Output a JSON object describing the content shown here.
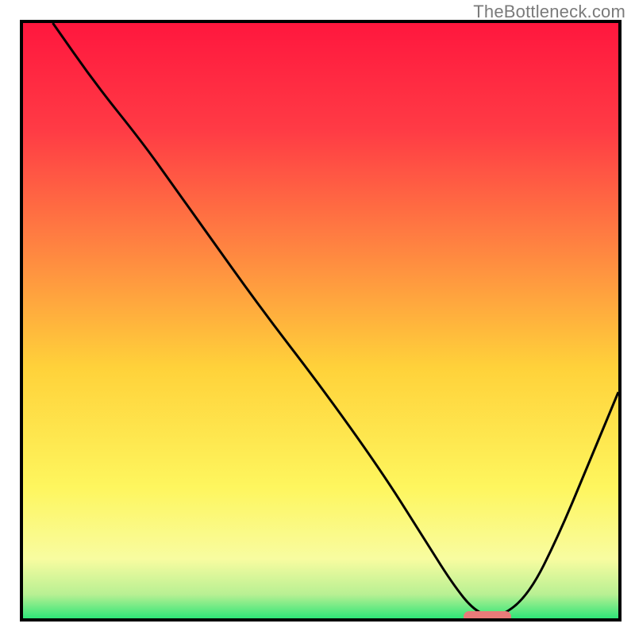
{
  "watermark": "TheBottleneck.com",
  "chart_data": {
    "type": "line",
    "title": "",
    "xlabel": "",
    "ylabel": "",
    "xlim": [
      0,
      100
    ],
    "ylim": [
      0,
      100
    ],
    "grid": false,
    "legend": "none",
    "background_gradient_stops": [
      {
        "pct": 0,
        "color": "#ff173e"
      },
      {
        "pct": 18,
        "color": "#ff3b45"
      },
      {
        "pct": 38,
        "color": "#ff8541"
      },
      {
        "pct": 58,
        "color": "#ffd23a"
      },
      {
        "pct": 78,
        "color": "#fef65e"
      },
      {
        "pct": 90,
        "color": "#f8fca0"
      },
      {
        "pct": 96,
        "color": "#b8f093"
      },
      {
        "pct": 100,
        "color": "#2fe578"
      }
    ],
    "series": [
      {
        "name": "bottleneck-curve",
        "color": "#000000",
        "x": [
          5,
          12,
          20,
          25,
          30,
          40,
          50,
          60,
          67,
          72,
          76,
          80,
          85,
          90,
          95,
          100
        ],
        "y": [
          100,
          90,
          80,
          73,
          66,
          52,
          39,
          25,
          14,
          6,
          1,
          0,
          4,
          14,
          26,
          38
        ]
      }
    ],
    "marker": {
      "name": "optimal-range",
      "x_start": 74,
      "x_end": 82,
      "y": 0,
      "color": "#e87b79"
    }
  }
}
